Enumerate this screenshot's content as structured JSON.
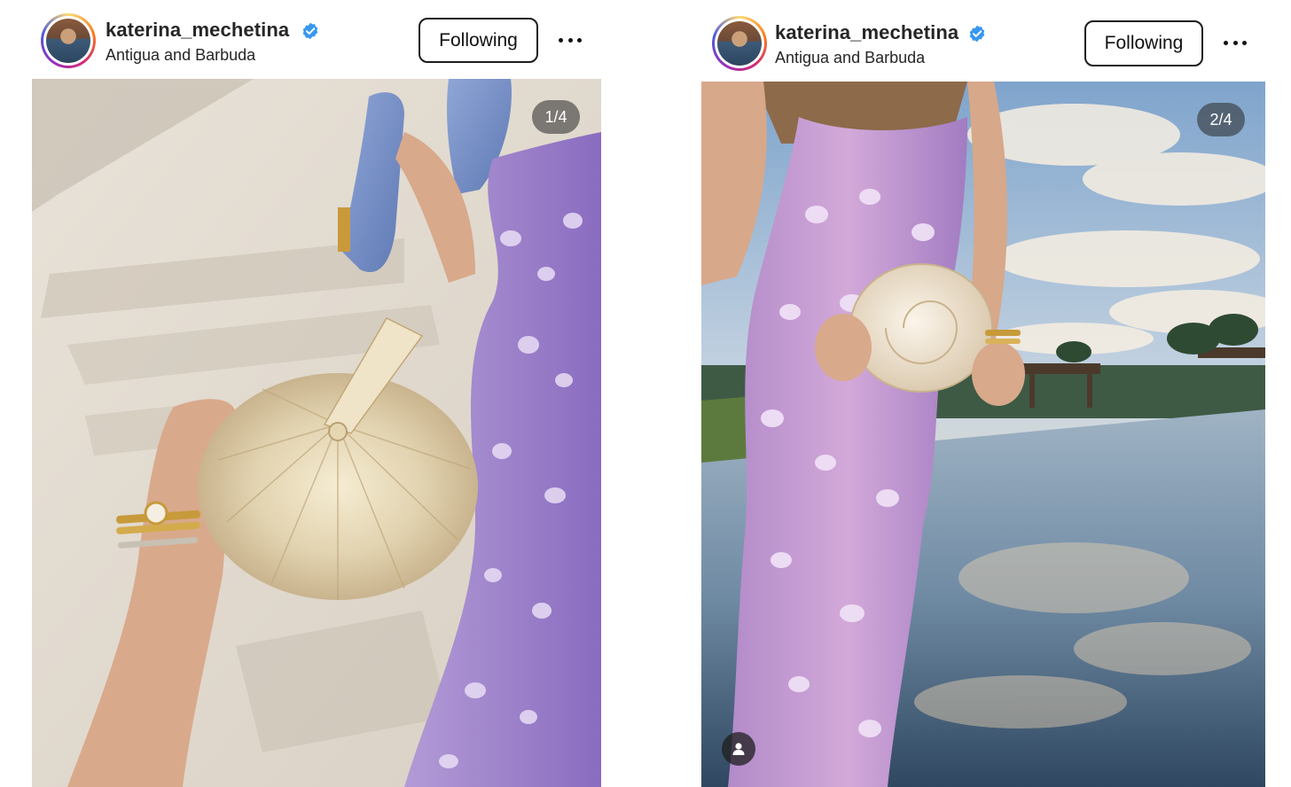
{
  "posts": [
    {
      "username": "katerina_mechetina",
      "location": "Antigua and Barbuda",
      "follow_label": "Following",
      "counter": "1/4",
      "icons": {
        "avatar": "profile-avatar",
        "verified": "verified-badge-icon",
        "more": "more-options-icon"
      },
      "colors": {
        "verified": "#3897f0"
      }
    },
    {
      "username": "katerina_mechetina",
      "location": "Antigua and Barbuda",
      "follow_label": "Following",
      "counter": "2/4",
      "icons": {
        "avatar": "profile-avatar",
        "verified": "verified-badge-icon",
        "more": "more-options-icon",
        "tag": "user-tag-icon"
      },
      "colors": {
        "verified": "#3897f0"
      }
    }
  ]
}
